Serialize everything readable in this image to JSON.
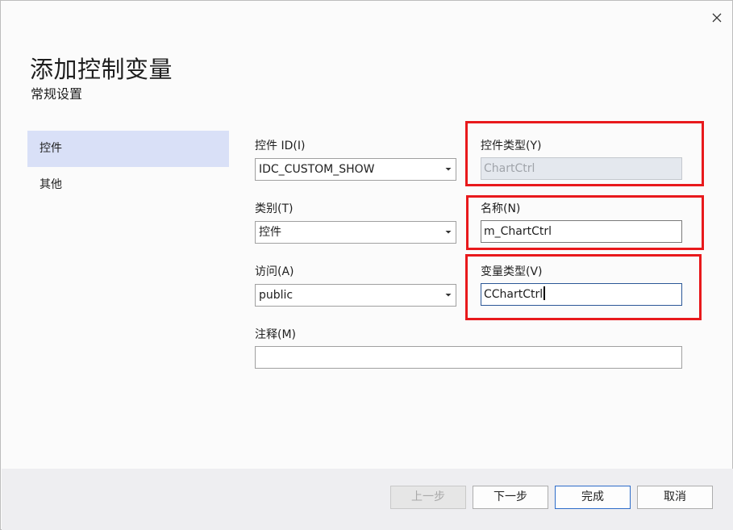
{
  "dialog": {
    "title": "添加控制变量",
    "subtitle": "常规设置"
  },
  "nav": {
    "items": [
      {
        "label": "控件",
        "selected": true
      },
      {
        "label": "其他",
        "selected": false
      }
    ]
  },
  "form": {
    "control_id": {
      "label": "控件 ID(I)",
      "value": "IDC_CUSTOM_SHOW"
    },
    "control_type": {
      "label": "控件类型(Y)",
      "value": "ChartCtrl"
    },
    "category": {
      "label": "类别(T)",
      "value": "控件"
    },
    "name": {
      "label": "名称(N)",
      "value": "m_ChartCtrl"
    },
    "access": {
      "label": "访问(A)",
      "value": "public"
    },
    "variable_type": {
      "label": "变量类型(V)",
      "value": "CChartCtrl"
    },
    "comment": {
      "label": "注释(M)",
      "value": ""
    }
  },
  "footer": {
    "prev_label": "上一步",
    "next_label": "下一步",
    "finish_label": "完成",
    "cancel_label": "取消"
  },
  "colors": {
    "highlight": "#e8191c",
    "selected_nav_bg": "#d9e0f7",
    "primary_border": "#2d6cc9"
  },
  "icons": {
    "close": "close-icon",
    "dropdown": "chevron-down-icon"
  }
}
